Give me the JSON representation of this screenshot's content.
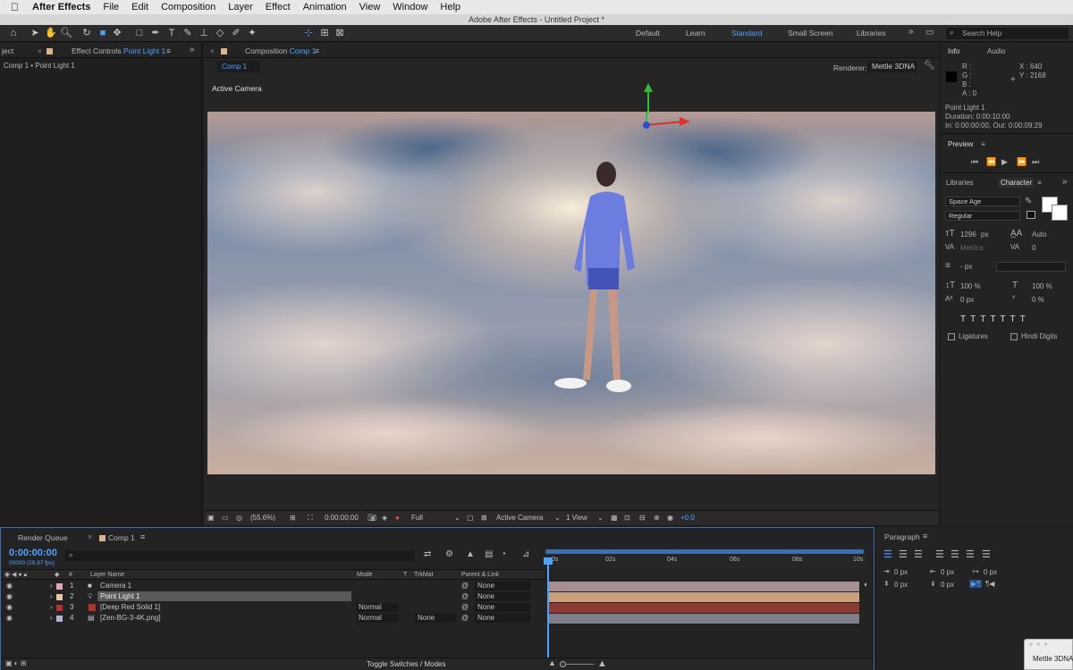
{
  "menubar": {
    "app": "After Effects",
    "items": [
      "File",
      "Edit",
      "Composition",
      "Layer",
      "Effect",
      "Animation",
      "View",
      "Window",
      "Help"
    ]
  },
  "window": {
    "title": "Adobe After Effects - Untitled Project *"
  },
  "workspaces": {
    "items": [
      "Default",
      "Learn",
      "Standard",
      "Small Screen",
      "Libraries"
    ],
    "active": "Standard"
  },
  "search": {
    "placeholder": "Search Help"
  },
  "left_panel": {
    "tab_project": "ject",
    "tab_effect_prefix": "Effect Controls",
    "tab_effect_layer": "Point Light 1",
    "breadcrumb": "Comp 1 • Point Light 1"
  },
  "comp_panel": {
    "tab_prefix": "Composition",
    "tab_name": "Comp 1",
    "subtab": "Comp 1",
    "renderer_label": "Renderer:",
    "renderer_value": "Mettle 3DNA",
    "view_label": "Active Camera"
  },
  "viewer_bar": {
    "zoom": "(55.6%)",
    "timecode": "0:00:00:00",
    "resolution": "Full",
    "camera": "Active Camera",
    "views": "1 View",
    "exposure": "+0.0"
  },
  "info": {
    "tab": "Info",
    "tab2": "Audio",
    "r": "R :",
    "g": "G :",
    "b": "B :",
    "a": "A : 0",
    "x": "X : 640",
    "y": "Y : 2168",
    "layer": "Point Light 1",
    "duration": "Duration: 0:00:10:00",
    "inout": "In: 0:00:00:00, Out: 0:00:09:29"
  },
  "preview": {
    "title": "Preview"
  },
  "character": {
    "tab1": "Libraries",
    "tab2": "Character",
    "font": "Space Age",
    "style": "Regular",
    "size": "1296",
    "size_unit": "px",
    "leading": "Auto",
    "kerning": "Metrics",
    "tracking": "0",
    "stroke": "- px",
    "vscale": "100 %",
    "hscale": "100 %",
    "baseline": "0 px",
    "tsume": "0 %",
    "ligatures": "Ligatures",
    "hindi": "Hindi Digits"
  },
  "timeline": {
    "tab_render": "Render Queue",
    "tab_comp": "Comp 1",
    "timecode": "0:00:00:00",
    "fps": "00000 (29.97 fps)",
    "col_num": "#",
    "col_name": "Layer Name",
    "col_mode": "Mode",
    "col_t": "T",
    "col_trkmat": "TrkMat",
    "col_parent": "Parent & Link",
    "ruler": [
      "0s",
      "02s",
      "04s",
      "06s",
      "08s",
      "10s"
    ],
    "toggle": "Toggle Switches / Modes",
    "layers": [
      {
        "num": "1",
        "name": "Camera 1",
        "mode": "",
        "trkmat": "",
        "parent": "None",
        "label": "#e7a4b6",
        "bar": "#a58f92"
      },
      {
        "num": "2",
        "name": "Point Light 1",
        "mode": "",
        "trkmat": "",
        "parent": "None",
        "label": "#e9c8a4",
        "bar": "#c9a17c"
      },
      {
        "num": "3",
        "name": "[Deep Red Solid 1]",
        "mode": "Normal",
        "trkmat": "",
        "parent": "None",
        "label": "#b5302b",
        "bar": "#8c3a32"
      },
      {
        "num": "4",
        "name": "[Zen-BG-3-4K.png]",
        "mode": "Normal",
        "trkmat": "None",
        "parent": "None",
        "label": "#b5b0d3",
        "bar": "#7f7f8c"
      }
    ]
  },
  "paragraph": {
    "title": "Paragraph",
    "indent_left": "0 px",
    "indent_right": "0 px",
    "space_before": "0 px",
    "indent_first": "0 px",
    "space_after": "0 px"
  },
  "corner_window": {
    "title": "Mettle 3DNA"
  }
}
